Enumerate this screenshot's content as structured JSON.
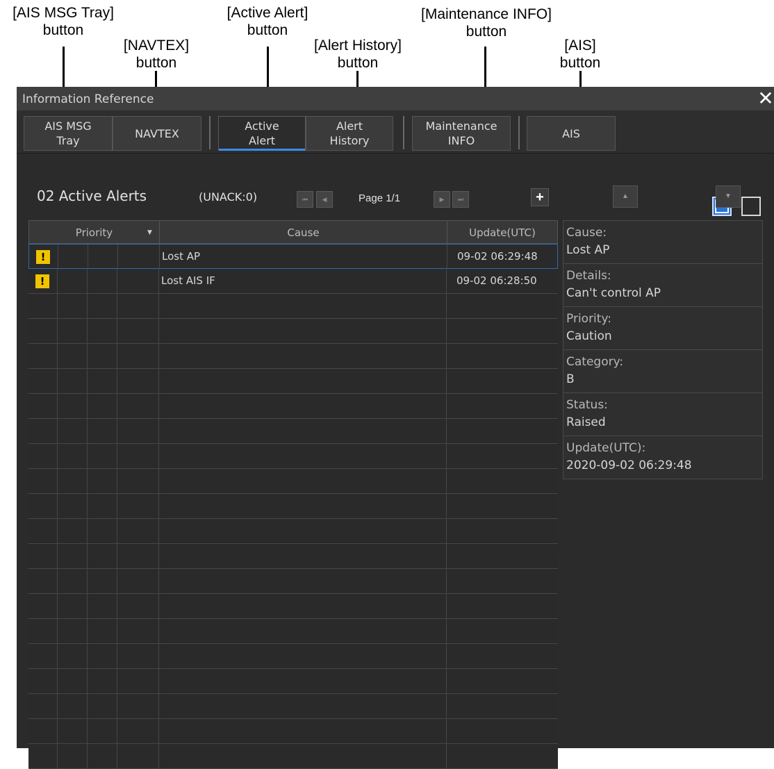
{
  "callouts": {
    "ais_msg_tray": {
      "line1": "[AIS MSG Tray]",
      "line2": "button"
    },
    "navtex": {
      "line1": "[NAVTEX]",
      "line2": "button"
    },
    "active_alert": {
      "line1": "[Active Alert]",
      "line2": "button"
    },
    "alert_history": {
      "line1": "[Alert History]",
      "line2": "button"
    },
    "maintenance_info": {
      "line1": "[Maintenance INFO]",
      "line2": "button"
    },
    "ais": {
      "line1": "[AIS]",
      "line2": "button"
    }
  },
  "window": {
    "title": "Information Reference",
    "close_glyph": "✕"
  },
  "toolbar": {
    "ais_msg_tray": "AIS MSG\nTray",
    "navtex": "NAVTEX",
    "active_alert": "Active\nAlert",
    "alert_history": "Alert\nHistory",
    "maintenance_info": "Maintenance\nINFO",
    "ais": "AIS"
  },
  "alerts_header": {
    "title": "02 Active Alerts",
    "unack": "(UNACK:0)",
    "page": "Page 1/1",
    "plus": "+"
  },
  "table": {
    "headers": {
      "priority": "Priority",
      "cause": "Cause",
      "update": "Update(UTC)"
    },
    "rows": [
      {
        "icon": "caution-icon",
        "badge": "!",
        "cause": "Lost AP",
        "update": "09-02 06:29:48",
        "selected": true
      },
      {
        "icon": "caution-icon",
        "badge": "!",
        "cause": "Lost AIS IF",
        "update": "09-02 06:28:50",
        "selected": false
      }
    ],
    "empty_rows": 19
  },
  "details": [
    {
      "label": "Cause:",
      "value": "Lost AP"
    },
    {
      "label": "Details:",
      "value": "Can't control AP"
    },
    {
      "label": "Priority:",
      "value": "Caution"
    },
    {
      "label": "Category:",
      "value": "B"
    },
    {
      "label": "Status:",
      "value": "Raised"
    },
    {
      "label": "Update(UTC):",
      "value": "2020-09-02 06:29:48"
    }
  ],
  "colors": {
    "accent": "#3d8be8",
    "caution": "#f0c400",
    "background": "#2b2b2b"
  }
}
